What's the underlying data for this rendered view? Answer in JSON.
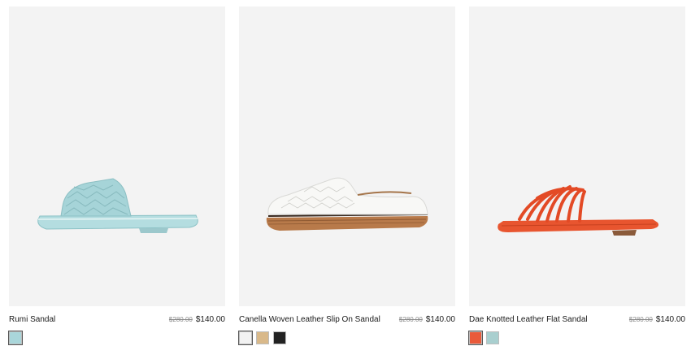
{
  "products": [
    {
      "name": "Rumi Sandal",
      "old_price": "$280.00",
      "price": "$140.00",
      "image_icon": "light-blue-woven-slide-sandal",
      "swatches": [
        {
          "name": "light-blue",
          "color": "#a9d6da"
        }
      ]
    },
    {
      "name": "Canella Woven Leather Slip On Sandal",
      "old_price": "$280.00",
      "price": "$140.00",
      "image_icon": "white-woven-mule-espadrille",
      "swatches": [
        {
          "name": "white",
          "color": "#f2f2f2"
        },
        {
          "name": "tan",
          "color": "#d9b98a"
        },
        {
          "name": "black",
          "color": "#222222"
        }
      ]
    },
    {
      "name": "Dae Knotted Leather Flat Sandal",
      "old_price": "$280.00",
      "price": "$140.00",
      "image_icon": "orange-knotted-strap-sandal",
      "swatches": [
        {
          "name": "orange",
          "color": "#ea5a3a"
        },
        {
          "name": "light-blue",
          "color": "#a9cfcf"
        }
      ]
    }
  ]
}
